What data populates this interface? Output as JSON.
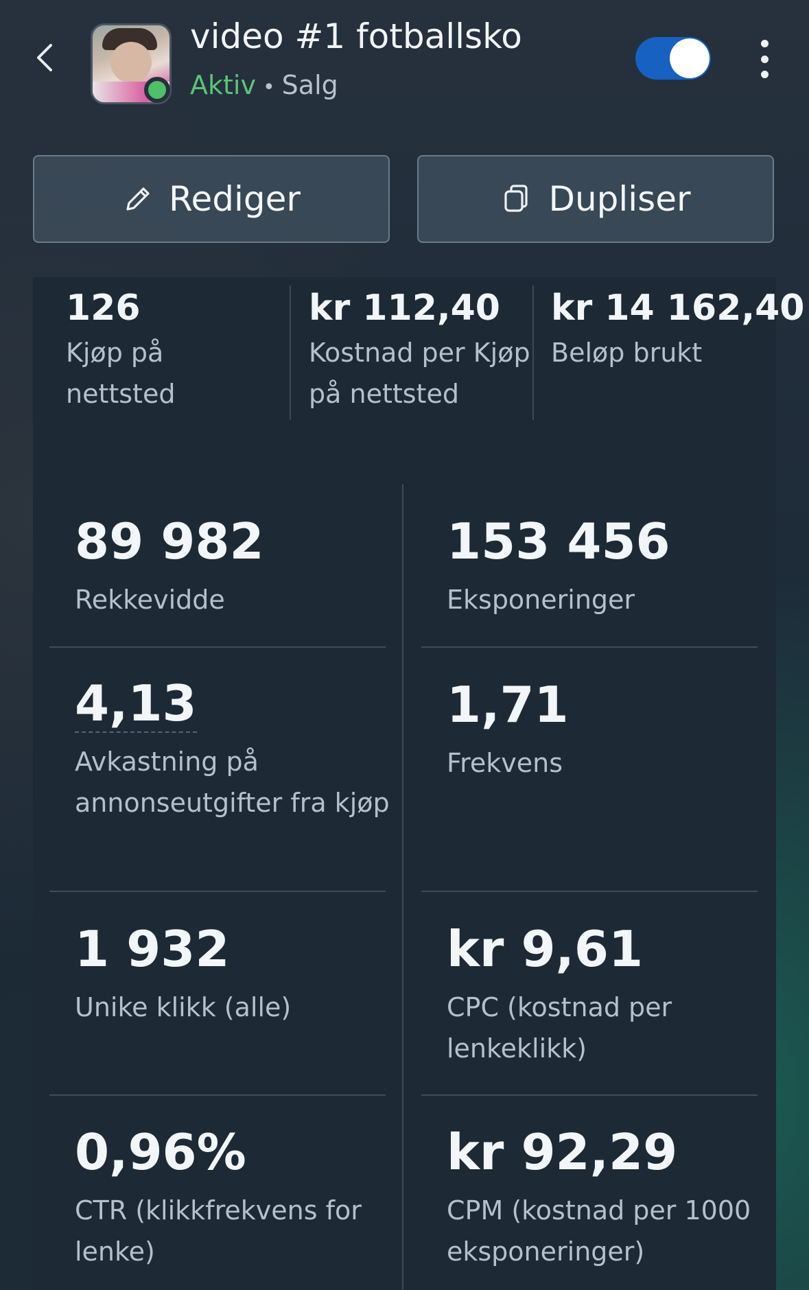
{
  "header": {
    "title": "video #1 fotballsko",
    "status": "Aktiv",
    "separator": "•",
    "objective": "Salg",
    "toggle_on": true,
    "colors": {
      "status_active": "#5cc47a",
      "toggle_track": "#1761c2"
    }
  },
  "actions": {
    "edit_label": "Rediger",
    "duplicate_label": "Dupliser"
  },
  "summary": [
    {
      "value": "126",
      "label": "Kjøp på nettsted"
    },
    {
      "value": "kr 112,40",
      "label": "Kostnad per Kjøp på nettsted"
    },
    {
      "value": "kr 14 162,40",
      "label": "Beløp brukt"
    }
  ],
  "metrics": [
    {
      "value": "89 982",
      "label": "Rekkevidde"
    },
    {
      "value": "153 456",
      "label": "Eksponeringer"
    },
    {
      "value": "4,13",
      "label": "Avkastning på annonseutgifter fra kjøp"
    },
    {
      "value": "1,71",
      "label": "Frekvens"
    },
    {
      "value": "1 932",
      "label": "Unike klikk (alle)"
    },
    {
      "value": "kr 9,61",
      "label": "CPC (kostnad per lenkeklikk)"
    },
    {
      "value": "0,96%",
      "label": "CTR (klikkfrekvens for lenke)"
    },
    {
      "value": "kr 92,29",
      "label": "CPM (kostnad per 1000 eksponeringer)"
    }
  ],
  "icons": {
    "back": "chevron-left-icon",
    "more": "more-vertical-icon",
    "edit": "pencil-icon",
    "duplicate": "copy-icon"
  }
}
